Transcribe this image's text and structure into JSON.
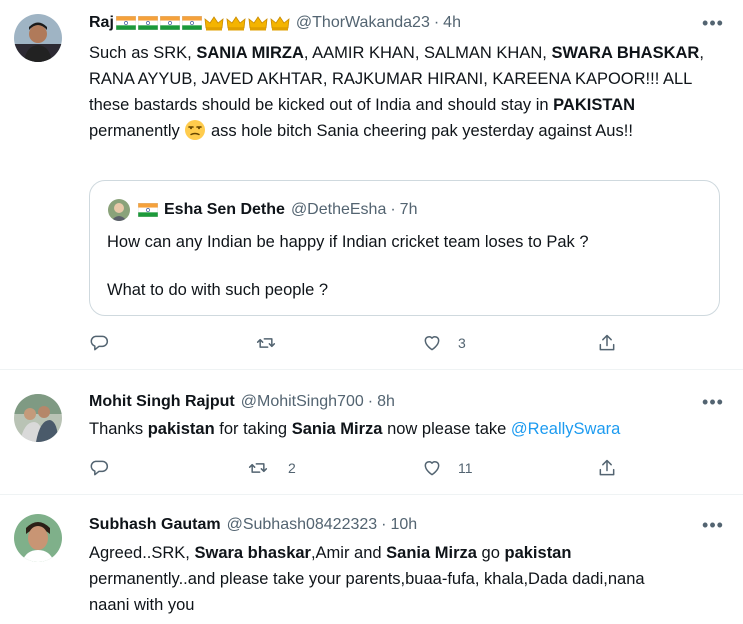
{
  "tweets": [
    {
      "name": "Raj",
      "handle": "@ThorWakanda23",
      "time": "4h",
      "text_parts": [
        {
          "t": "Such as SRK, ",
          "b": false
        },
        {
          "t": "SANIA MIRZA",
          "b": true
        },
        {
          "t": ", AAMIR KHAN, SALMAN KHAN, ",
          "b": false
        },
        {
          "t": "SWARA BHASKAR",
          "b": true
        },
        {
          "t": ", RANA AYYUB, JAVED AKHTAR, RAJKUMAR HIRANI, KAREENA KAPOOR!!! ALL these bastards should be kicked out of India and should stay in ",
          "b": false
        },
        {
          "t": "PAKISTAN",
          "b": true
        },
        {
          "t": " permanently ",
          "b": false
        },
        {
          "t": " ass hole bitch Sania cheering pak yesterday against Aus!!",
          "b": false
        }
      ],
      "quote": {
        "name": "Esha Sen Dethe",
        "handle": "@DetheEsha",
        "time": "7h",
        "line1": "How can any Indian be happy if Indian cricket team loses to Pak ?",
        "line2": "What to do with such people ?"
      },
      "reply_count": "",
      "retweet_count": "",
      "like_count": "3"
    },
    {
      "name": "Mohit Singh Rajput",
      "handle": "@MohitSingh700",
      "time": "8h",
      "text_parts": [
        {
          "t": "Thanks ",
          "b": false
        },
        {
          "t": "pakistan",
          "b": true
        },
        {
          "t": " for taking ",
          "b": false
        },
        {
          "t": "Sania Mirza",
          "b": true
        },
        {
          "t": " now please take ",
          "b": false
        }
      ],
      "mention": "@ReallySwara",
      "reply_count": "",
      "retweet_count": "2",
      "like_count": "11"
    },
    {
      "name": "Subhash Gautam",
      "handle": "@Subhash08422323",
      "time": "10h",
      "text_parts": [
        {
          "t": "Agreed..SRK, ",
          "b": false
        },
        {
          "t": "Swara bhaskar",
          "b": true
        },
        {
          "t": ",Amir and ",
          "b": false
        },
        {
          "t": "Sania Mirza",
          "b": true
        },
        {
          "t": " go ",
          "b": false
        },
        {
          "t": "pakistan",
          "b": true
        },
        {
          "t": " permanently..and please take your parents,buaa-fufa, khala,Dada dadi,nana naani with you",
          "b": false
        }
      ]
    }
  ],
  "colors": {
    "text": "#0f1419",
    "secondary": "#536471",
    "link": "#1d9bf0",
    "border": "#cfd9de",
    "divider": "#eff3f4"
  },
  "icons": [
    "more-icon",
    "reply-icon",
    "retweet-icon",
    "like-icon",
    "share-icon",
    "india-flag-icon",
    "crown-icon",
    "unamused-face-icon"
  ]
}
